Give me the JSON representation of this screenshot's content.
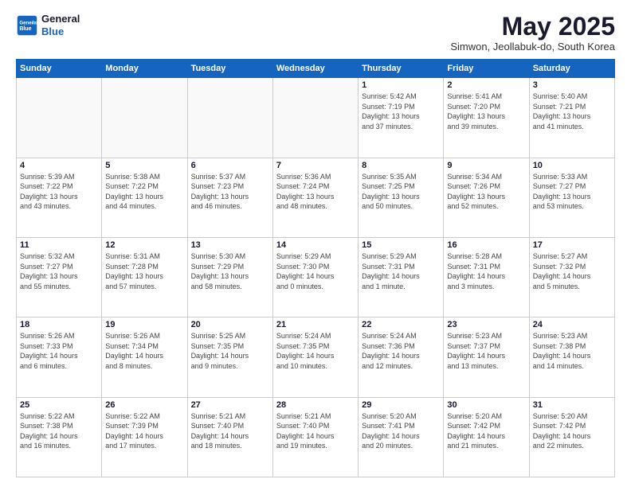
{
  "header": {
    "logo_line1": "General",
    "logo_line2": "Blue",
    "month": "May 2025",
    "location": "Simwon, Jeollabuk-do, South Korea"
  },
  "weekdays": [
    "Sunday",
    "Monday",
    "Tuesday",
    "Wednesday",
    "Thursday",
    "Friday",
    "Saturday"
  ],
  "weeks": [
    [
      {
        "day": "",
        "info": ""
      },
      {
        "day": "",
        "info": ""
      },
      {
        "day": "",
        "info": ""
      },
      {
        "day": "",
        "info": ""
      },
      {
        "day": "1",
        "info": "Sunrise: 5:42 AM\nSunset: 7:19 PM\nDaylight: 13 hours\nand 37 minutes."
      },
      {
        "day": "2",
        "info": "Sunrise: 5:41 AM\nSunset: 7:20 PM\nDaylight: 13 hours\nand 39 minutes."
      },
      {
        "day": "3",
        "info": "Sunrise: 5:40 AM\nSunset: 7:21 PM\nDaylight: 13 hours\nand 41 minutes."
      }
    ],
    [
      {
        "day": "4",
        "info": "Sunrise: 5:39 AM\nSunset: 7:22 PM\nDaylight: 13 hours\nand 43 minutes."
      },
      {
        "day": "5",
        "info": "Sunrise: 5:38 AM\nSunset: 7:22 PM\nDaylight: 13 hours\nand 44 minutes."
      },
      {
        "day": "6",
        "info": "Sunrise: 5:37 AM\nSunset: 7:23 PM\nDaylight: 13 hours\nand 46 minutes."
      },
      {
        "day": "7",
        "info": "Sunrise: 5:36 AM\nSunset: 7:24 PM\nDaylight: 13 hours\nand 48 minutes."
      },
      {
        "day": "8",
        "info": "Sunrise: 5:35 AM\nSunset: 7:25 PM\nDaylight: 13 hours\nand 50 minutes."
      },
      {
        "day": "9",
        "info": "Sunrise: 5:34 AM\nSunset: 7:26 PM\nDaylight: 13 hours\nand 52 minutes."
      },
      {
        "day": "10",
        "info": "Sunrise: 5:33 AM\nSunset: 7:27 PM\nDaylight: 13 hours\nand 53 minutes."
      }
    ],
    [
      {
        "day": "11",
        "info": "Sunrise: 5:32 AM\nSunset: 7:27 PM\nDaylight: 13 hours\nand 55 minutes."
      },
      {
        "day": "12",
        "info": "Sunrise: 5:31 AM\nSunset: 7:28 PM\nDaylight: 13 hours\nand 57 minutes."
      },
      {
        "day": "13",
        "info": "Sunrise: 5:30 AM\nSunset: 7:29 PM\nDaylight: 13 hours\nand 58 minutes."
      },
      {
        "day": "14",
        "info": "Sunrise: 5:29 AM\nSunset: 7:30 PM\nDaylight: 14 hours\nand 0 minutes."
      },
      {
        "day": "15",
        "info": "Sunrise: 5:29 AM\nSunset: 7:31 PM\nDaylight: 14 hours\nand 1 minute."
      },
      {
        "day": "16",
        "info": "Sunrise: 5:28 AM\nSunset: 7:31 PM\nDaylight: 14 hours\nand 3 minutes."
      },
      {
        "day": "17",
        "info": "Sunrise: 5:27 AM\nSunset: 7:32 PM\nDaylight: 14 hours\nand 5 minutes."
      }
    ],
    [
      {
        "day": "18",
        "info": "Sunrise: 5:26 AM\nSunset: 7:33 PM\nDaylight: 14 hours\nand 6 minutes."
      },
      {
        "day": "19",
        "info": "Sunrise: 5:26 AM\nSunset: 7:34 PM\nDaylight: 14 hours\nand 8 minutes."
      },
      {
        "day": "20",
        "info": "Sunrise: 5:25 AM\nSunset: 7:35 PM\nDaylight: 14 hours\nand 9 minutes."
      },
      {
        "day": "21",
        "info": "Sunrise: 5:24 AM\nSunset: 7:35 PM\nDaylight: 14 hours\nand 10 minutes."
      },
      {
        "day": "22",
        "info": "Sunrise: 5:24 AM\nSunset: 7:36 PM\nDaylight: 14 hours\nand 12 minutes."
      },
      {
        "day": "23",
        "info": "Sunrise: 5:23 AM\nSunset: 7:37 PM\nDaylight: 14 hours\nand 13 minutes."
      },
      {
        "day": "24",
        "info": "Sunrise: 5:23 AM\nSunset: 7:38 PM\nDaylight: 14 hours\nand 14 minutes."
      }
    ],
    [
      {
        "day": "25",
        "info": "Sunrise: 5:22 AM\nSunset: 7:38 PM\nDaylight: 14 hours\nand 16 minutes."
      },
      {
        "day": "26",
        "info": "Sunrise: 5:22 AM\nSunset: 7:39 PM\nDaylight: 14 hours\nand 17 minutes."
      },
      {
        "day": "27",
        "info": "Sunrise: 5:21 AM\nSunset: 7:40 PM\nDaylight: 14 hours\nand 18 minutes."
      },
      {
        "day": "28",
        "info": "Sunrise: 5:21 AM\nSunset: 7:40 PM\nDaylight: 14 hours\nand 19 minutes."
      },
      {
        "day": "29",
        "info": "Sunrise: 5:20 AM\nSunset: 7:41 PM\nDaylight: 14 hours\nand 20 minutes."
      },
      {
        "day": "30",
        "info": "Sunrise: 5:20 AM\nSunset: 7:42 PM\nDaylight: 14 hours\nand 21 minutes."
      },
      {
        "day": "31",
        "info": "Sunrise: 5:20 AM\nSunset: 7:42 PM\nDaylight: 14 hours\nand 22 minutes."
      }
    ]
  ]
}
